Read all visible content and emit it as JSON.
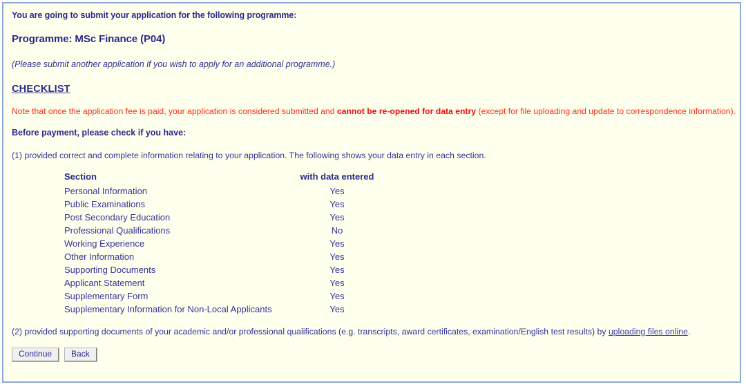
{
  "panel": {
    "intro_line": "You are going to submit your application for the following programme:",
    "programme_line": "Programme: MSc Finance (P04)",
    "another_application_note": "(Please submit another application if you wish to apply for an additional programme.)",
    "checklist_heading": "CHECKLIST"
  },
  "warning": {
    "prefix": "Note that once the application fee is paid, your application is considered submitted and ",
    "bold": "cannot be re-opened for data entry",
    "suffix": " (except for file uploading and update to correspondence information)."
  },
  "before_payment": {
    "heading": "Before payment, please check if you have:",
    "item1": "(1) provided correct and complete information relating to your application. The following shows your data entry in each section."
  },
  "section_table": {
    "columns": [
      "Section",
      "with data entered"
    ],
    "rows": [
      {
        "section": "Personal Information",
        "entered": "Yes"
      },
      {
        "section": "Public Examinations",
        "entered": "Yes"
      },
      {
        "section": "Post Secondary Education",
        "entered": "Yes"
      },
      {
        "section": "Professional Qualifications",
        "entered": "No"
      },
      {
        "section": "Working Experience",
        "entered": "Yes"
      },
      {
        "section": "Other Information",
        "entered": "Yes"
      },
      {
        "section": "Supporting Documents",
        "entered": "Yes"
      },
      {
        "section": "Applicant Statement",
        "entered": "Yes"
      },
      {
        "section": "Supplementary Form",
        "entered": "Yes"
      },
      {
        "section": "Supplementary Information for Non-Local Applicants",
        "entered": "Yes"
      }
    ]
  },
  "item2": {
    "prefix": "(2) provided supporting documents of your academic and/or professional qualifications (e.g. transcripts, award certificates, examination/English test results) by ",
    "link": "uploading files online",
    "suffix": "."
  },
  "buttons": {
    "continue_label": "Continue",
    "back_label": "Back"
  },
  "colors": {
    "panel_background": "#ffffed",
    "panel_border": "#89a9d8",
    "text_blue": "#333399",
    "heading_blue": "#2b2b8c",
    "warning_red": "#ff2b18",
    "warning_red_bold": "#ee0d0d",
    "link_blue": "#3b3bb0"
  }
}
